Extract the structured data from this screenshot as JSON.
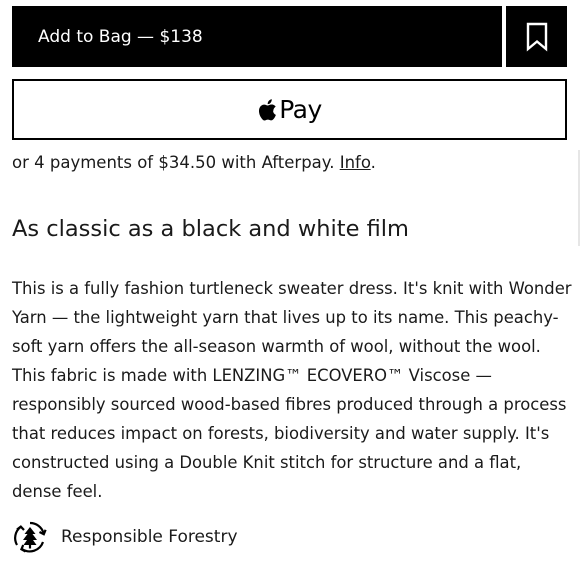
{
  "purchase": {
    "add_to_bag_label": "Add to Bag — $138",
    "wishlist_icon": "bookmark-icon",
    "apple_pay_logo": "apple-logo-icon",
    "apple_pay_label": "Pay"
  },
  "afterpay": {
    "text": "or 4 payments of $34.50 with Afterpay. ",
    "link_label": "Info",
    "suffix": "."
  },
  "product": {
    "heading": "As classic as a black and white film",
    "description": "This is a fully fashion turtleneck sweater dress. It's knit with Wonder Yarn — the lightweight yarn that lives up to its name. This peachy-soft yarn offers the all-season warmth of wool, without the wool. This fabric is made with LENZING™ ECOVERO™ Viscose — responsibly sourced wood-based fibres produced through a process that reduces impact on forests, biodiversity and water supply. It's constructed using a Double Knit stitch for structure and a flat, dense feel."
  },
  "badge": {
    "icon": "forest-recycle-icon",
    "label": "Responsible Forestry"
  },
  "colors": {
    "primary": "#000000",
    "on_primary": "#ffffff",
    "text": "#1a1a1a",
    "background": "#ffffff"
  }
}
